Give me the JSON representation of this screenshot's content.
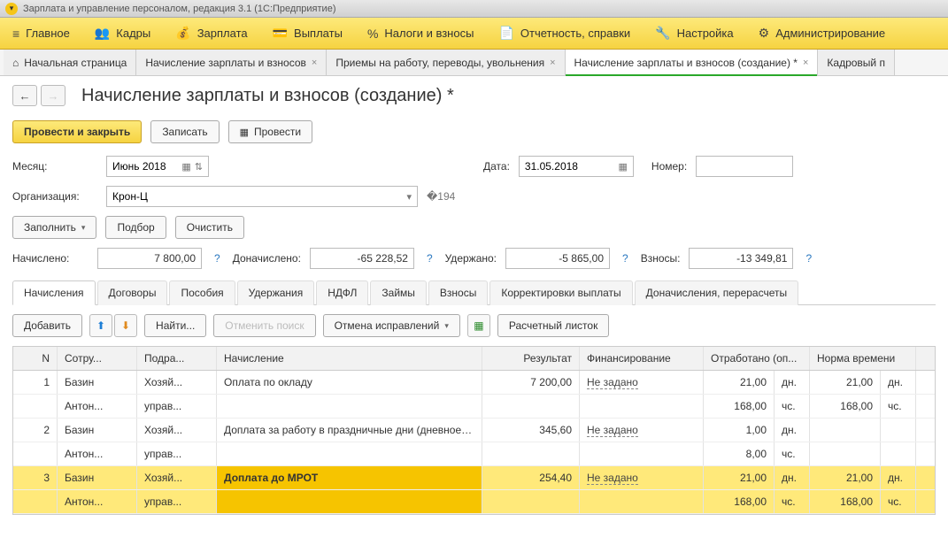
{
  "app": {
    "title": "Зарплата и управление персоналом, редакция 3.1  (1С:Предприятие)"
  },
  "mainnav": [
    {
      "label": "Главное",
      "icon": "≡"
    },
    {
      "label": "Кадры",
      "icon": "👥"
    },
    {
      "label": "Зарплата",
      "icon": "💰"
    },
    {
      "label": "Выплаты",
      "icon": "💳"
    },
    {
      "label": "Налоги и взносы",
      "icon": "%"
    },
    {
      "label": "Отчетность, справки",
      "icon": "📄"
    },
    {
      "label": "Настройка",
      "icon": "🔧"
    },
    {
      "label": "Администрирование",
      "icon": "⚙"
    }
  ],
  "tabs": [
    {
      "label": "Начальная страница",
      "icon": "⌂",
      "close": false
    },
    {
      "label": "Начисление зарплаты и взносов",
      "close": true
    },
    {
      "label": "Приемы на работу, переводы, увольнения",
      "close": true
    },
    {
      "label": "Начисление зарплаты и взносов (создание) *",
      "close": true,
      "active": true
    },
    {
      "label": "Кадровый п",
      "close": false
    }
  ],
  "page": {
    "title": "Начисление зарплаты и взносов (создание) *",
    "buttons": {
      "post_close": "Провести и закрыть",
      "save": "Записать",
      "post": "Провести"
    },
    "form": {
      "month_lbl": "Месяц:",
      "month_val": "Июнь 2018",
      "date_lbl": "Дата:",
      "date_val": "31.05.2018",
      "num_lbl": "Номер:",
      "num_val": "",
      "org_lbl": "Организация:",
      "org_val": "Крон-Ц",
      "fill": "Заполнить",
      "pick": "Подбор",
      "clear": "Очистить",
      "accrued_lbl": "Начислено:",
      "accrued_val": "7 800,00",
      "addl_lbl": "Доначислено:",
      "addl_val": "-65 228,52",
      "withheld_lbl": "Удержано:",
      "withheld_val": "-5 865,00",
      "contrib_lbl": "Взносы:",
      "contrib_val": "-13 349,81"
    },
    "tabs2": [
      "Начисления",
      "Договоры",
      "Пособия",
      "Удержания",
      "НДФЛ",
      "Займы",
      "Взносы",
      "Корректировки выплаты",
      "Доначисления, перерасчеты"
    ],
    "toolbar2": {
      "add": "Добавить",
      "find": "Найти...",
      "cancel_find": "Отменить поиск",
      "undo_fix": "Отмена исправлений",
      "slip": "Расчетный листок"
    },
    "cols": {
      "n": "N",
      "emp": "Сотру...",
      "dept": "Подра...",
      "calc": "Начисление",
      "res": "Результат",
      "fin": "Финансирование",
      "worked": "Отработано (оп...",
      "norm": "Норма времени"
    },
    "units": {
      "days": "дн.",
      "hours": "чс."
    },
    "fin_default": "Не задано",
    "rows": [
      {
        "n": "1",
        "emp": "Базин Антон...",
        "dept": "Хозяй... управ...",
        "calc": "Оплата по окладу",
        "res": "7 200,00",
        "wd": "21,00",
        "wh": "168,00",
        "nd": "21,00",
        "nh": "168,00"
      },
      {
        "n": "2",
        "emp": "Базин Антон...",
        "dept": "Хозяй... управ...",
        "calc": "Доплата за работу в праздничные дни (дневное время)",
        "res": "345,60",
        "wd": "1,00",
        "wh": "8,00",
        "nd": "",
        "nh": ""
      },
      {
        "n": "3",
        "emp": "Базин Антон...",
        "dept": "Хозяй... управ...",
        "calc": "Доплата до МРОТ",
        "res": "254,40",
        "wd": "21,00",
        "wh": "168,00",
        "nd": "21,00",
        "nh": "168,00",
        "selected": true
      }
    ]
  }
}
